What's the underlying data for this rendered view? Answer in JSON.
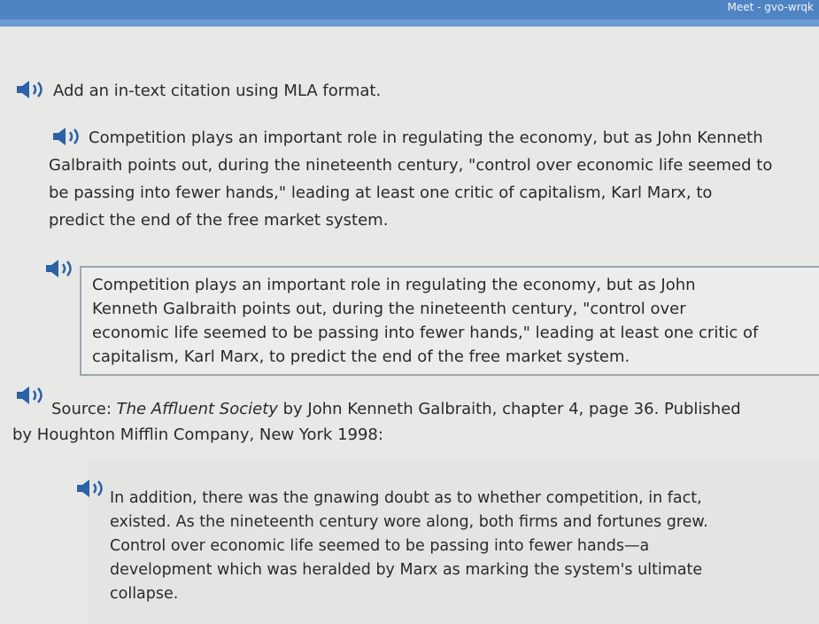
{
  "topbar": {
    "corner_text": "Meet - gvo-wrqk"
  },
  "instruction": "Add an in-text citation using MLA format.",
  "passage": {
    "lines": [
      "Competition plays an important role in regulating the economy, but as John Kenneth",
      "Galbraith points out, during the nineteenth century, \"control over economic life seemed to",
      "be passing into fewer hands,\" leading at least one critic of capitalism, Karl Marx, to",
      "predict the end of the free market system."
    ]
  },
  "answer_box": {
    "lines": [
      "Competition plays an important role in regulating the economy, but as John",
      "Kenneth Galbraith points out, during the nineteenth century, \"control over",
      "economic life seemed to be passing into fewer hands,\" leading at least one critic of",
      "capitalism, Karl Marx, to predict the end of the free market system."
    ]
  },
  "source": {
    "prefix": "Source: ",
    "title": "The Affluent Society",
    "rest_line1": " by John Kenneth Galbraith, chapter 4, page 36. Published",
    "line2": "by Houghton Mifflin Company, New York 1998:"
  },
  "quote": {
    "lines": [
      "In addition, there was the gnawing doubt as to whether competition, in fact,",
      "existed. As the nineteenth century wore along, both firms and fortunes grew.",
      "Control over economic life seemed to be passing into fewer hands—a",
      "development which was heralded by Marx as marking the system's ultimate",
      "collapse."
    ]
  },
  "icons": {
    "speaker": "speaker-icon",
    "color": "#2b62a8"
  }
}
